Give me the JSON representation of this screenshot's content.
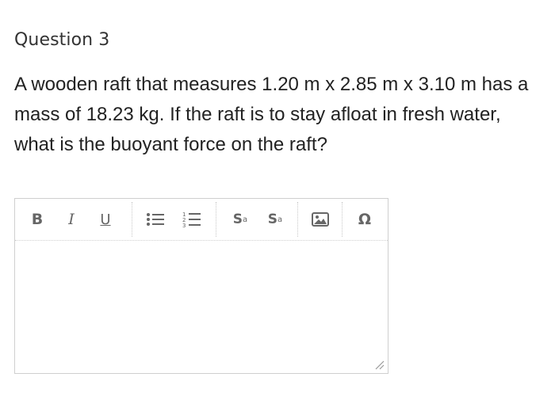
{
  "question": {
    "title": "Question 3",
    "text": "A wooden raft that measures 1.20 m x 2.85 m x 3.10 m has a mass of 18.23 kg. If the raft is to stay afloat in fresh water, what is the buoyant force on the raft?"
  },
  "editor": {
    "toolbar": {
      "bold_label": "B",
      "italic_label": "I",
      "underline_label": "U",
      "superscript_label": "S",
      "superscript_mark": "a",
      "subscript_label": "S",
      "subscript_mark": "a",
      "special_char_label": "Ω"
    },
    "icons": [
      "bulleted-list-icon",
      "numbered-list-icon",
      "image-icon",
      "resize-handle-icon"
    ],
    "colors": {
      "icon": "#666666",
      "border": "#cfcfcf"
    }
  }
}
